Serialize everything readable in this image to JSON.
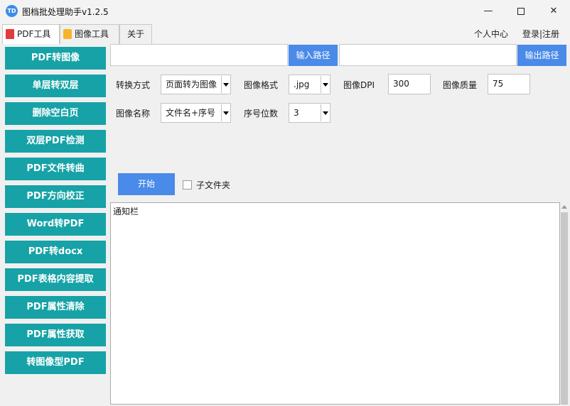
{
  "window": {
    "icon_text": "TD",
    "title": "图档批处理助手v1.2.5",
    "minimize": "—",
    "close": "✕"
  },
  "tabs": [
    {
      "label": "PDF工具",
      "icon": "pdf-icon",
      "active": true
    },
    {
      "label": "图像工具",
      "icon": "image-icon",
      "active": false
    },
    {
      "label": "关于",
      "icon": "",
      "active": false
    }
  ],
  "top_links": {
    "user_center": "个人中心",
    "login": "登录|注册"
  },
  "sidebar": {
    "items": [
      {
        "label": "PDF转图像"
      },
      {
        "label": "单层转双层"
      },
      {
        "label": "删除空白页"
      },
      {
        "label": "双层PDF检测"
      },
      {
        "label": "PDF文件转曲"
      },
      {
        "label": "PDF方向校正"
      },
      {
        "label": "Word转PDF"
      },
      {
        "label": "PDF转docx"
      },
      {
        "label": "PDF表格内容提取"
      },
      {
        "label": "PDF属性清除"
      },
      {
        "label": "PDF属性获取"
      },
      {
        "label": "转图像型PDF"
      }
    ]
  },
  "paths": {
    "input_value": "",
    "input_button": "输入路径",
    "output_value": "",
    "output_button": "输出路径"
  },
  "options": {
    "convert_mode": {
      "label": "转换方式",
      "value": "页面转为图像"
    },
    "image_format": {
      "label": "图像格式",
      "value": ".jpg"
    },
    "image_dpi": {
      "label": "图像DPI",
      "value": "300"
    },
    "image_quality": {
      "label": "图像质量",
      "value": "75"
    },
    "image_name": {
      "label": "图像名称",
      "value": "文件名+序号"
    },
    "serial_digits": {
      "label": "序号位数",
      "value": "3"
    }
  },
  "actions": {
    "start": "开始",
    "subfolder": "子文件夹",
    "subfolder_checked": false
  },
  "notice": {
    "title": "通知栏"
  },
  "colors": {
    "sidebar_button": "#16a2a6",
    "primary_button": "#4a8ae8",
    "app_icon": "#3b8de6"
  }
}
